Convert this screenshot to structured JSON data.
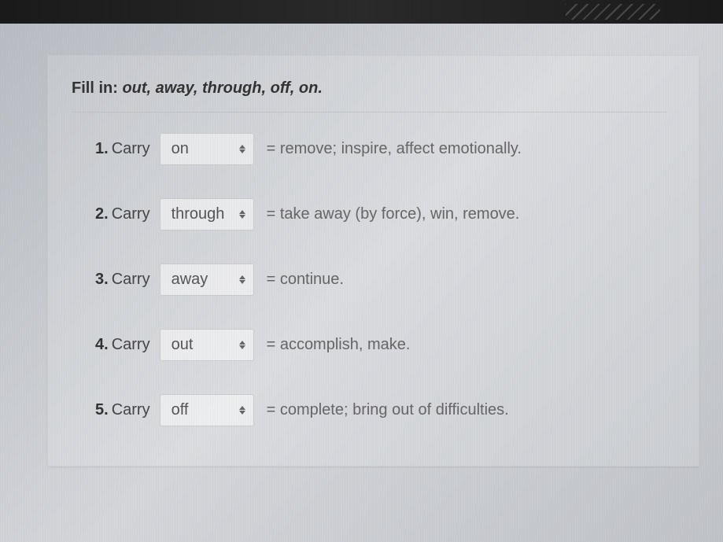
{
  "instruction": {
    "lead": "Fill in:",
    "options": "out, away, through, off, on."
  },
  "items": [
    {
      "num": "1.",
      "word": "Carry",
      "selected": "on",
      "definition": "= remove; inspire, affect emotionally."
    },
    {
      "num": "2.",
      "word": "Carry",
      "selected": "through",
      "definition": "= take away (by force), win, remove."
    },
    {
      "num": "3.",
      "word": "Carry",
      "selected": "away",
      "definition": "= continue."
    },
    {
      "num": "4.",
      "word": "Carry",
      "selected": "out",
      "definition": "= accomplish, make."
    },
    {
      "num": "5.",
      "word": "Carry",
      "selected": "off",
      "definition": "= complete; bring out of difficulties."
    }
  ]
}
